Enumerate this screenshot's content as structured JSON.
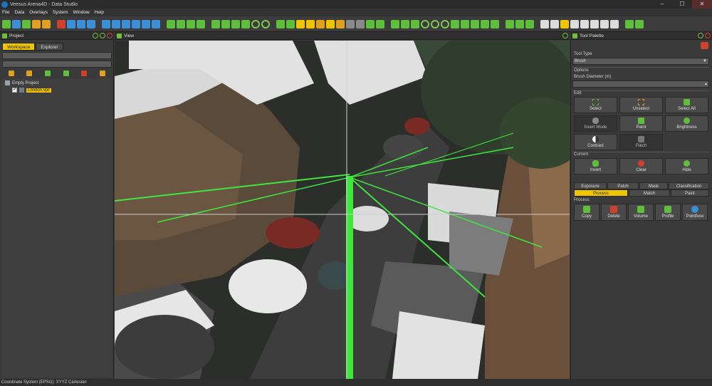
{
  "window": {
    "title": "Veesus Arena4D - Data Studio",
    "controls": [
      "–",
      "☐",
      "✕"
    ]
  },
  "menu": [
    "File",
    "Data",
    "Overlays",
    "System",
    "Window",
    "Help"
  ],
  "project_panel": {
    "title": "Project",
    "tabs": [
      {
        "label": "Workspace",
        "active": true
      },
      {
        "label": "Explorer",
        "active": false
      }
    ],
    "tree": {
      "root": "Empty Project",
      "child": "London.vpc"
    }
  },
  "view_panel": {
    "title": "View"
  },
  "tool_palette": {
    "title": "Tool Palette",
    "tool_type_label": "Tool Type",
    "tool_type_value": "Brush",
    "options_label": "Options",
    "brush_diameter_label": "Brush Diameter (m)",
    "edit_label": "Edit",
    "edit_buttons": [
      {
        "label": "Select",
        "icon": "select-icon",
        "enabled": true
      },
      {
        "label": "Unselect",
        "icon": "unselect-icon",
        "enabled": true
      },
      {
        "label": "Select All",
        "icon": "select-all-icon",
        "enabled": true
      },
      {
        "label": "Invert Mode",
        "icon": "invert-mode-icon",
        "enabled": false
      },
      {
        "label": "Paint",
        "icon": "paint-brush-icon",
        "enabled": true
      },
      {
        "label": "Brightness",
        "icon": "brightness-icon",
        "enabled": true
      },
      {
        "label": "Contrast",
        "icon": "contrast-icon",
        "enabled": true
      },
      {
        "label": "Patch",
        "icon": "hammer-icon",
        "enabled": false
      }
    ],
    "current_label": "Current",
    "current_buttons": [
      {
        "label": "Invert",
        "icon": "invert-icon"
      },
      {
        "label": "Clear",
        "icon": "clear-icon"
      },
      {
        "label": "Hide",
        "icon": "eye-icon"
      }
    ],
    "tabs_row1": [
      {
        "label": "Exposure",
        "active": false
      },
      {
        "label": "Patch",
        "active": false
      },
      {
        "label": "Mask",
        "active": false
      },
      {
        "label": "Classification",
        "active": false
      }
    ],
    "tabs_row2": [
      {
        "label": "Process",
        "active": true
      },
      {
        "label": "Match",
        "active": false
      },
      {
        "label": "Paint",
        "active": false
      }
    ],
    "process_label": "Process",
    "process_buttons": [
      {
        "label": "Copy",
        "icon": "copy-icon"
      },
      {
        "label": "Delete",
        "icon": "delete-icon"
      },
      {
        "label": "Volume",
        "icon": "volume-icon"
      },
      {
        "label": "Profile",
        "icon": "profile-icon"
      },
      {
        "label": "Pointfuse",
        "icon": "pointfuse-icon"
      }
    ]
  },
  "status": {
    "text": "Coordinate System (EPSG): XYYZ Cartesian"
  },
  "colors": {
    "accent": "#f0c400",
    "green": "#5fbf3c",
    "red": "#d04030"
  }
}
